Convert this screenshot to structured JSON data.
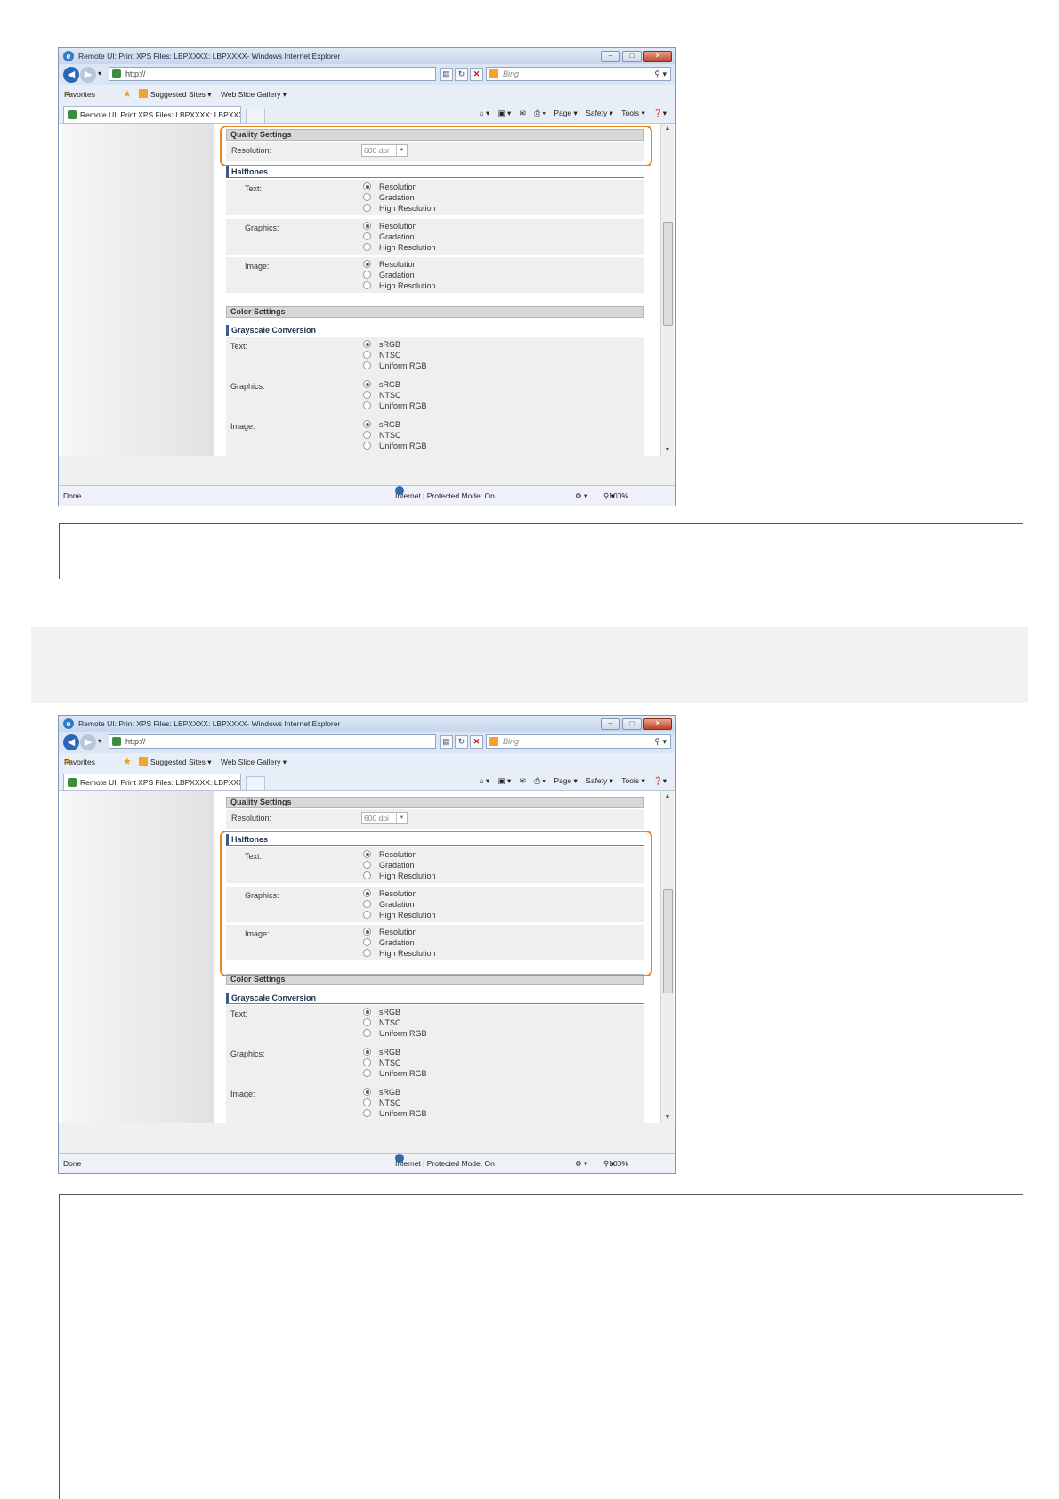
{
  "screenshots": [
    {
      "window": {
        "title": "Remote UI: Print XPS Files: LBPXXXX: LBPXXXX- Windows Internet Explorer",
        "address": "http://",
        "search_placeholder": "Bing",
        "favorites_label": "Favorites",
        "suggested_sites": "Suggested Sites ▾",
        "web_slice": "Web Slice Gallery ▾",
        "tab_title": "Remote UI: Print XPS Files: LBPXXXX: LBPXXXX",
        "cmd_page": "Page ▾",
        "cmd_safety": "Safety ▾",
        "cmd_tools": "Tools ▾",
        "status_done": "Done",
        "status_zone": "Internet | Protected Mode: On",
        "zoom": "100%"
      },
      "highlighted_section": "Quality Settings"
    },
    {
      "window": {
        "title": "Remote UI: Print XPS Files: LBPXXXX: LBPXXXX- Windows Internet Explorer",
        "address": "http://",
        "search_placeholder": "Bing",
        "favorites_label": "Favorites",
        "suggested_sites": "Suggested Sites ▾",
        "web_slice": "Web Slice Gallery ▾",
        "tab_title": "Remote UI: Print XPS Files: LBPXXXX: LBPXXXX",
        "cmd_page": "Page ▾",
        "cmd_safety": "Safety ▾",
        "cmd_tools": "Tools ▾",
        "status_done": "Done",
        "status_zone": "Internet | Protected Mode: On",
        "zoom": "100%"
      },
      "highlighted_section": "Halftones"
    }
  ],
  "form": {
    "quality_settings": {
      "header": "Quality Settings",
      "resolution_label": "Resolution:",
      "resolution_value": "600 dpi"
    },
    "halftones": {
      "header": "Halftones",
      "rows": [
        {
          "label": "Text:",
          "options": [
            "Resolution",
            "Gradation",
            "High Resolution"
          ],
          "selected": 0
        },
        {
          "label": "Graphics:",
          "options": [
            "Resolution",
            "Gradation",
            "High Resolution"
          ],
          "selected": 0
        },
        {
          "label": "Image:",
          "options": [
            "Resolution",
            "Gradation",
            "High Resolution"
          ],
          "selected": 0
        }
      ]
    },
    "color_settings": {
      "header": "Color Settings",
      "subheader": "Grayscale Conversion",
      "rows": [
        {
          "label": "Text:",
          "options": [
            "sRGB",
            "NTSC",
            "Uniform RGB"
          ],
          "selected": 0
        },
        {
          "label": "Graphics:",
          "options": [
            "sRGB",
            "NTSC",
            "Uniform RGB"
          ],
          "selected": 0
        },
        {
          "label": "Image:",
          "options": [
            "sRGB",
            "NTSC",
            "Uniform RGB"
          ],
          "selected": 0
        }
      ]
    }
  },
  "colors": {
    "highlight": "#e8841e",
    "section_header_bg": "#d8d8d8",
    "subheader_accent": "#3c5a8a"
  }
}
